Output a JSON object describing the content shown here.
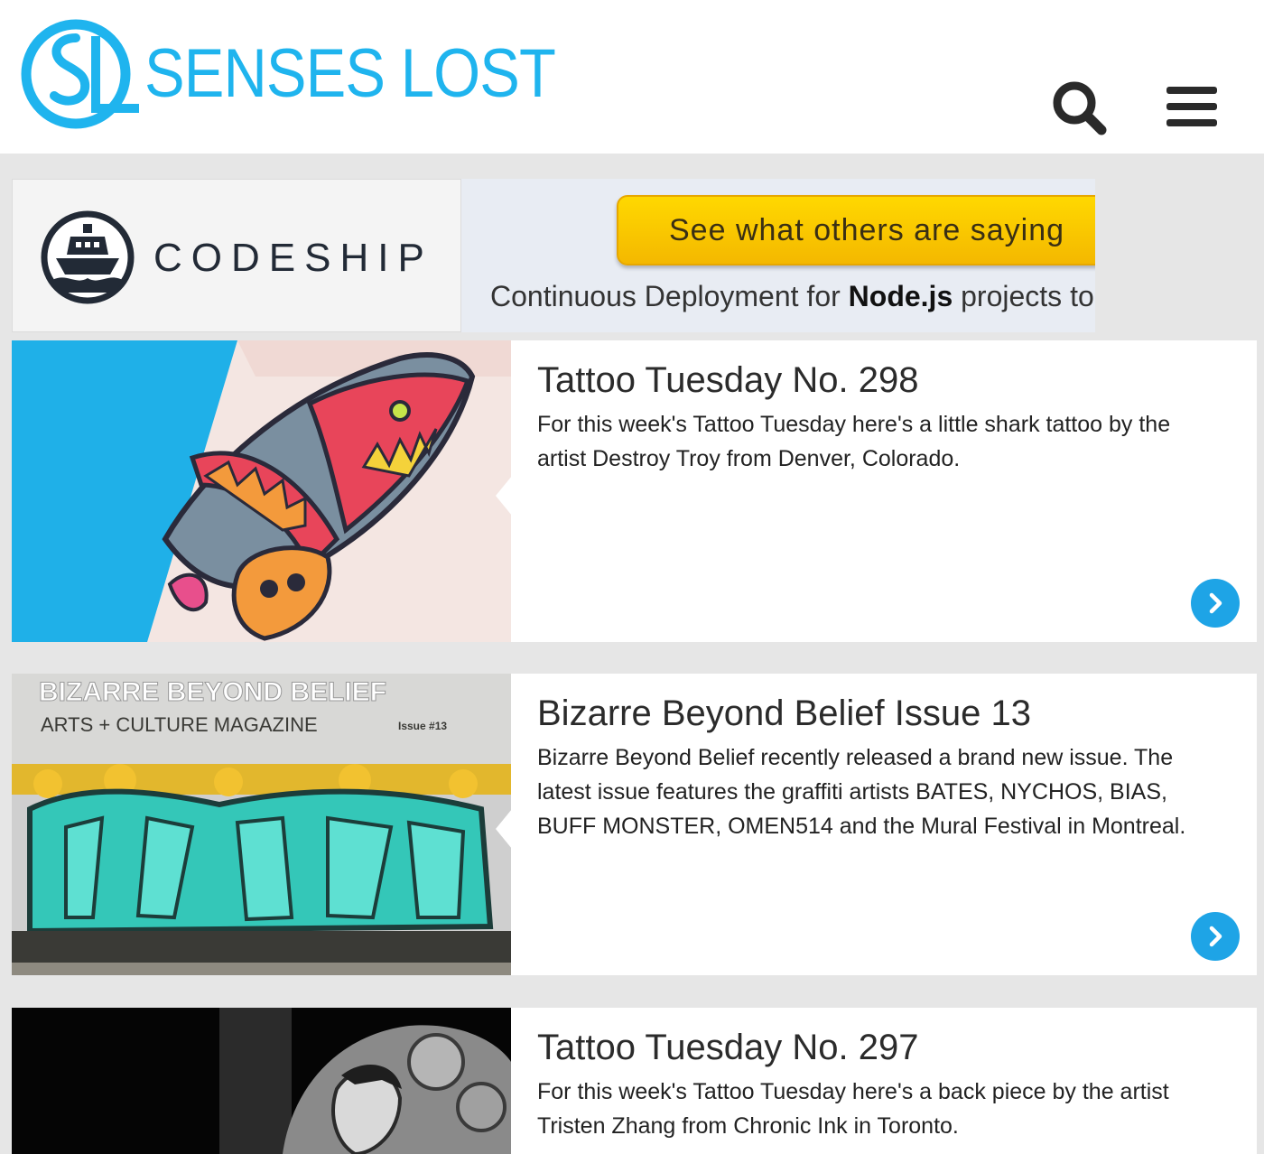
{
  "site": {
    "name": "SENSES LOST",
    "brand_color": "#1fb4ee",
    "icons": {
      "search": "search-icon",
      "menu": "hamburger-menu-icon"
    }
  },
  "ad": {
    "brand": "CODESHIP",
    "cta_label": "See what others are saying",
    "tagline_prefix": "Continuous Deployment for ",
    "tagline_bold": "Node.js",
    "tagline_suffix": " projects to"
  },
  "articles": [
    {
      "title": "Tattoo Tuesday No. 298",
      "excerpt": "For this week's Tattoo Tuesday here's a little shark tattoo by the artist Destroy Troy from Denver, Colorado."
    },
    {
      "title": "Bizarre Beyond Belief Issue 13",
      "excerpt": "Bizarre Beyond Belief recently released a brand new issue. The latest issue features the graffiti artists BATES, NYCHOS, BIAS, BUFF MONSTER, OMEN514 and the Mural Festival in Montreal.",
      "image_text": {
        "masthead": "BIZARRE BEYOND BELIEF",
        "subtitle": "ARTS + CULTURE MAGAZINE",
        "issue": "Issue #13"
      }
    },
    {
      "title": "Tattoo Tuesday No. 297",
      "excerpt": "For this week's Tattoo Tuesday here's a back piece by the artist Tristen Zhang from Chronic Ink in Toronto."
    }
  ],
  "colors": {
    "accent": "#1ea4e6",
    "page_background": "#e6e6e6",
    "cta_yellow": "#ffd000"
  }
}
